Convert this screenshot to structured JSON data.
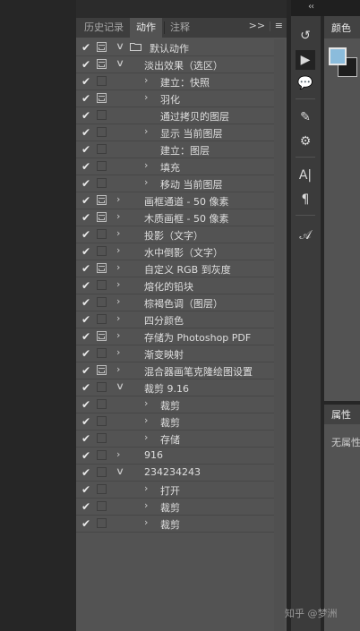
{
  "panel": {
    "tabs": [
      {
        "label": "历史记录"
      },
      {
        "label": "动作",
        "active": true
      },
      {
        "label": "注释"
      }
    ],
    "tab_overflow": ">>",
    "menu_icon": "hamburger-menu-icon"
  },
  "actions": [
    {
      "level": 0,
      "label": "默认动作",
      "type": "set",
      "expanded": true,
      "checked": true,
      "dialog": true
    },
    {
      "level": 1,
      "label": "淡出效果（选区）",
      "type": "action",
      "expanded": true,
      "checked": true,
      "dialog": true
    },
    {
      "level": 2,
      "label": "建立：快照",
      "type": "step",
      "expandable": true,
      "checked": true,
      "dialog": false
    },
    {
      "level": 2,
      "label": "羽化",
      "type": "step",
      "expandable": true,
      "checked": true,
      "dialog": true
    },
    {
      "level": 2,
      "label": "通过拷贝的图层",
      "type": "step",
      "expandable": false,
      "checked": true,
      "dialog": false
    },
    {
      "level": 2,
      "label": "显示 当前图层",
      "type": "step",
      "expandable": true,
      "checked": true,
      "dialog": false
    },
    {
      "level": 2,
      "label": "建立：图层",
      "type": "step",
      "expandable": false,
      "checked": true,
      "dialog": false
    },
    {
      "level": 2,
      "label": "填充",
      "type": "step",
      "expandable": true,
      "checked": true,
      "dialog": false
    },
    {
      "level": 2,
      "label": "移动 当前图层",
      "type": "step",
      "expandable": true,
      "checked": true,
      "dialog": false
    },
    {
      "level": 1,
      "label": "画框通道 - 50 像素",
      "type": "action",
      "expanded": false,
      "checked": true,
      "dialog": true
    },
    {
      "level": 1,
      "label": "木质画框 - 50 像素",
      "type": "action",
      "expanded": false,
      "checked": true,
      "dialog": true
    },
    {
      "level": 1,
      "label": "投影（文字）",
      "type": "action",
      "expanded": false,
      "checked": true,
      "dialog": false
    },
    {
      "level": 1,
      "label": "水中倒影（文字）",
      "type": "action",
      "expanded": false,
      "checked": true,
      "dialog": false
    },
    {
      "level": 1,
      "label": "自定义 RGB 到灰度",
      "type": "action",
      "expanded": false,
      "checked": true,
      "dialog": true
    },
    {
      "level": 1,
      "label": "熔化的铅块",
      "type": "action",
      "expanded": false,
      "checked": true,
      "dialog": false
    },
    {
      "level": 1,
      "label": "棕褐色调（图层）",
      "type": "action",
      "expanded": false,
      "checked": true,
      "dialog": false
    },
    {
      "level": 1,
      "label": "四分颜色",
      "type": "action",
      "expanded": false,
      "checked": true,
      "dialog": false
    },
    {
      "level": 1,
      "label": "存储为 Photoshop PDF",
      "type": "action",
      "expanded": false,
      "checked": true,
      "dialog": true
    },
    {
      "level": 1,
      "label": "渐变映射",
      "type": "action",
      "expanded": false,
      "checked": true,
      "dialog": false
    },
    {
      "level": 1,
      "label": "混合器画笔克隆绘图设置",
      "type": "action",
      "expanded": false,
      "checked": true,
      "dialog": true
    },
    {
      "level": 1,
      "label": "裁剪 9.16",
      "type": "action",
      "expanded": true,
      "checked": true,
      "dialog": false
    },
    {
      "level": 2,
      "label": "裁剪",
      "type": "step",
      "expandable": true,
      "checked": true,
      "dialog": false
    },
    {
      "level": 2,
      "label": "裁剪",
      "type": "step",
      "expandable": true,
      "checked": true,
      "dialog": false
    },
    {
      "level": 2,
      "label": "存储",
      "type": "step",
      "expandable": true,
      "checked": true,
      "dialog": false
    },
    {
      "level": 1,
      "label": "916",
      "type": "action",
      "expanded": false,
      "checked": true,
      "dialog": false
    },
    {
      "level": 1,
      "label": "234234243",
      "type": "action",
      "expanded": true,
      "checked": true,
      "dialog": false
    },
    {
      "level": 2,
      "label": "打开",
      "type": "step",
      "expandable": true,
      "checked": true,
      "dialog": false
    },
    {
      "level": 2,
      "label": "裁剪",
      "type": "step",
      "expandable": true,
      "checked": true,
      "dialog": false
    },
    {
      "level": 2,
      "label": "裁剪",
      "type": "step",
      "expandable": true,
      "checked": true,
      "dialog": false
    }
  ],
  "toolstrip": {
    "collapse": "‹‹",
    "tools": [
      {
        "name": "history-brush-icon",
        "glyph": "↺"
      },
      {
        "name": "play-icon",
        "glyph": "▶",
        "active": true
      },
      {
        "name": "comment-icon",
        "glyph": "💬"
      },
      {
        "name": "brush-icon",
        "glyph": "✎"
      },
      {
        "name": "brush-settings-icon",
        "glyph": "⚙"
      },
      {
        "name": "character-icon",
        "glyph": "A|"
      },
      {
        "name": "paragraph-icon",
        "glyph": "¶"
      },
      {
        "name": "glyphs-icon",
        "glyph": "𝒜"
      }
    ]
  },
  "right_panels": {
    "color_tab": "颜色",
    "properties_tab": "属性",
    "properties_empty": "无属性"
  },
  "watermark": "知乎 @梦洲",
  "colors": {
    "foreground": "#8bbcdc",
    "background": "#1e1e1e",
    "panel": "#535353"
  }
}
